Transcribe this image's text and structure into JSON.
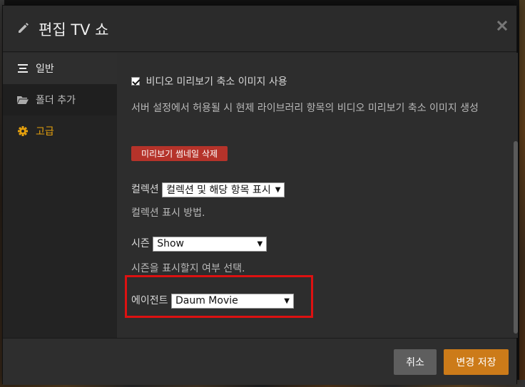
{
  "dialog": {
    "title": "편집 TV 쇼",
    "close_icon": "close-icon",
    "title_icon": "pencil-icon"
  },
  "sidebar": {
    "items": [
      {
        "label": "일반",
        "icon": "list-icon"
      },
      {
        "label": "폴더 추가",
        "icon": "folder-icon"
      },
      {
        "label": "고급",
        "icon": "gear-icon"
      }
    ]
  },
  "content": {
    "checkbox_label": "비디오 미리보기 축소 이미지 사용",
    "checkbox_checked": true,
    "checkbox_hint": "서버 설정에서 허용될 시 현제 라이브러리 항목의 비디오 미리보기 축소 이미지 생성",
    "delete_thumbs_button": "미리보기 썸네일 삭제",
    "collection_label": "컬렉션",
    "collection_value": "컬렉션 및 해당 항목 표시",
    "collection_hint": "컬렉션 표시 방법.",
    "season_label": "시즌",
    "season_value": "Show",
    "season_hint": "시즌을 표시할지 여부 선택.",
    "agent_label": "에이전트",
    "agent_value": "Daum Movie"
  },
  "footer": {
    "cancel_label": "취소",
    "save_label": "변경 저장"
  },
  "colors": {
    "accent": "#e5a00d",
    "save_button": "#cc7b19",
    "danger_button": "#b5332a",
    "highlight_box": "#dd1111"
  }
}
